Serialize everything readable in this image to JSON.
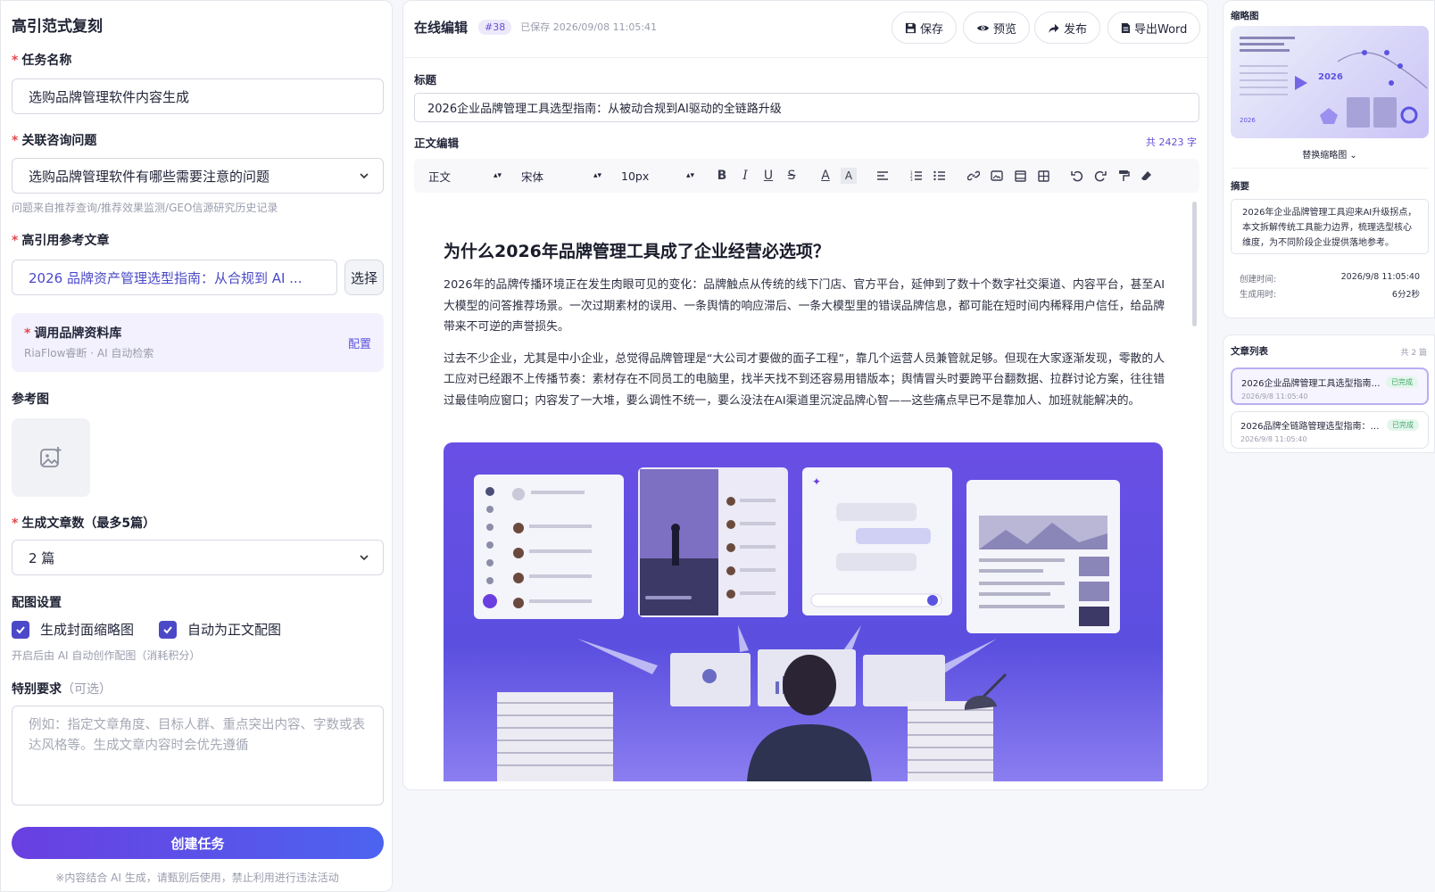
{
  "left": {
    "title": "高引范式复刻",
    "task_name_label": "任务名称",
    "task_name_value": "选购品牌管理软件内容生成",
    "question_label": "关联咨询问题",
    "question_value": "选购品牌管理软件有哪些需要注意的问题",
    "question_hint": "问题来自推荐查询/推荐效果监测/GEO信源研究历史记录",
    "ref_article_label": "高引用参考文章",
    "ref_article_value": "2026 品牌资产管理选型指南：从合规到 AI ...",
    "select_label": "选择",
    "kb_title": "调用品牌资料库",
    "kb_sub": "RiaFlow睿断 · AI 自动检索",
    "kb_config": "配置",
    "ref_image_label": "参考图",
    "count_label": "生成文章数（最多5篇）",
    "count_value": "2 篇",
    "image_settings_label": "配图设置",
    "cover_label": "生成封面缩略图",
    "auto_image_label": "自动为正文配图",
    "image_hint": "开启后由 AI 自动创作配图（消耗积分）",
    "special_label": "特别要求",
    "special_optional": "（可选）",
    "special_placeholder": "例如：指定文章角度、目标人群、重点突出内容、字数或表达风格等。生成文章内容时会优先遵循",
    "create_button": "创建任务",
    "disclaimer": "※内容结合 AI 生成，请甄别后使用，禁止利用进行违法活动"
  },
  "editor": {
    "name": "在线编辑",
    "badge": "#38",
    "saved": "已保存 2026/09/08 11:05:41",
    "save": "保存",
    "preview": "预览",
    "publish": "发布",
    "export": "导出Word",
    "title_label": "标题",
    "title_value": "2026企业品牌管理工具选型指南：从被动合规到AI驱动的全链路升级",
    "body_label": "正文编辑",
    "word_count": "共 2423 字",
    "toolbar": {
      "style": "正文",
      "font": "宋体",
      "size": "10px"
    },
    "heading": "为什么2026年品牌管理工具成了企业经营必选项？",
    "para1": "2026年的品牌传播环境正在发生肉眼可见的变化：品牌触点从传统的线下门店、官方平台，延伸到了数十个数字社交渠道、内容平台，甚至AI大模型的问答推荐场景。一次过期素材的误用、一条舆情的响应滞后、一条大模型里的错误品牌信息，都可能在短时间内稀释用户信任，给品牌带来不可逆的声誉损失。",
    "para2": "过去不少企业，尤其是中小企业，总觉得品牌管理是“大公司才要做的面子工程”，靠几个运营人员兼管就足够。但现在大家逐渐发现，零散的人工应对已经跟不上传播节奏：素材存在不同员工的电脑里，找半天找不到还容易用错版本；舆情冒头时要跨平台翻数据、拉群讨论方案，往往错过最佳响应窗口；内容发了一大堆，要么调性不统一，要么没法在AI渠道里沉淀品牌心智——这些痛点早已不是靠加人、加班就能解决的。"
  },
  "right": {
    "thumb_label": "缩略图",
    "thumb_year": "2026",
    "replace": "替换缩略图",
    "summary_label": "摘要",
    "summary": "2026年企业品牌管理工具迎来AI升级拐点，本文拆解传统工具能力边界，梳理选型核心维度，为不同阶段企业提供落地参考。",
    "created_label": "创建时间:",
    "created_value": "2026/9/8 11:05:40",
    "duration_label": "生成用时:",
    "duration_value": "6分2秒",
    "list_label": "文章列表",
    "list_count": "共 2 篇",
    "articles": [
      {
        "title": "2026企业品牌管理工具选型指南：...",
        "date": "2026/9/8 11:05:40",
        "status": "已完成"
      },
      {
        "title": "2026品牌全链路管理选型指南：从...",
        "date": "2026/9/8 11:05:40",
        "status": "已完成"
      }
    ]
  },
  "colors": {
    "accent": "#4b49c7",
    "gradient_start": "#6a3fe0",
    "gradient_end": "#4c63f0",
    "required": "#e5484d"
  }
}
